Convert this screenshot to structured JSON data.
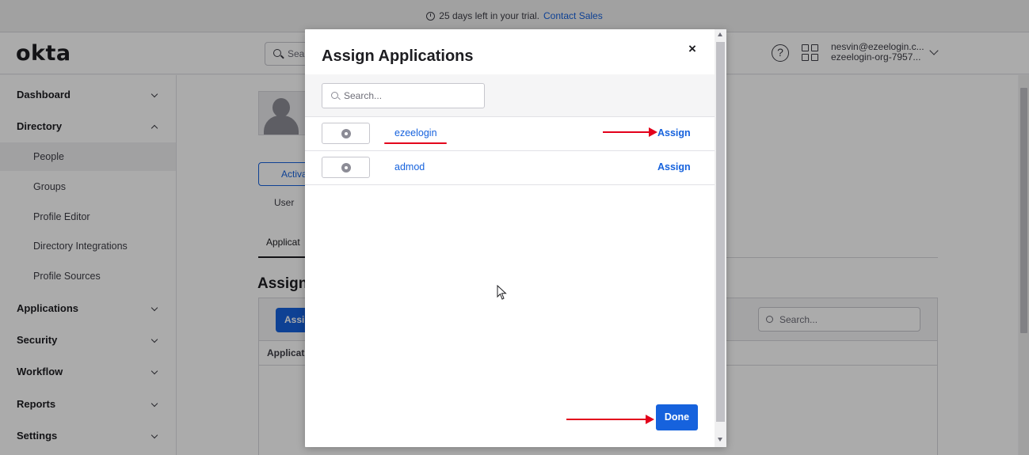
{
  "banner": {
    "text": "25 days left in your trial.",
    "link": "Contact Sales"
  },
  "header": {
    "logo": "okta",
    "search_placeholder": "Sea",
    "user_email": "nesvin@ezeelogin.c...",
    "user_org": "ezeelogin-org-7957..."
  },
  "sidebar": {
    "items": [
      {
        "label": "Dashboard"
      },
      {
        "label": "Directory"
      },
      {
        "label": "People"
      },
      {
        "label": "Groups"
      },
      {
        "label": "Profile Editor"
      },
      {
        "label": "Directory Integrations"
      },
      {
        "label": "Profile Sources"
      },
      {
        "label": "Applications"
      },
      {
        "label": "Security"
      },
      {
        "label": "Workflow"
      },
      {
        "label": "Reports"
      },
      {
        "label": "Settings"
      }
    ]
  },
  "background": {
    "activate_label": "Activa",
    "user_label": "User",
    "tab_label": "Applicat",
    "heading": "Assign",
    "assign_btn": "Assi",
    "search_placeholder": "Search...",
    "column_header": "Applicat"
  },
  "modal": {
    "title": "Assign Applications",
    "close": "×",
    "search_placeholder": "Search...",
    "apps": [
      {
        "name": "ezeelogin",
        "action": "Assign"
      },
      {
        "name": "admod",
        "action": "Assign"
      }
    ],
    "done_label": "Done"
  },
  "colors": {
    "accent": "#1662dd",
    "annotation": "#e3001b"
  }
}
